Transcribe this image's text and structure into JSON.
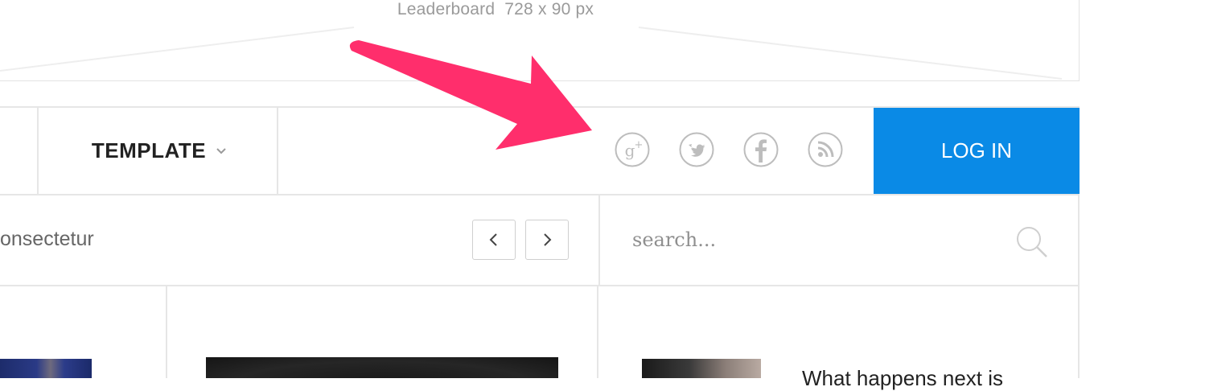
{
  "leaderboard": {
    "label": "Leaderboard  728 x 90 px"
  },
  "nav": {
    "menu_item": "TEMPLATE",
    "social_icons": [
      "google-plus-icon",
      "twitter-icon",
      "facebook-icon",
      "rss-icon"
    ],
    "login_label": "LOG IN"
  },
  "ticker": {
    "text": "onsectetur"
  },
  "search": {
    "placeholder": "search..."
  },
  "article": {
    "snippet": "What happens next is"
  },
  "colors": {
    "accent": "#0a8ae6",
    "annotation_arrow": "#ff2e6c",
    "border": "#e6e6e6",
    "icon_gray": "#bdbdbd"
  }
}
